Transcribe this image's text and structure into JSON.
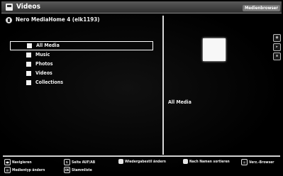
{
  "header": {
    "title": "Videos",
    "browser_label": "Medienbrowser"
  },
  "server": {
    "label": "Nero MediaHome 4 (elk1193)"
  },
  "menu": {
    "items": [
      {
        "label": "All Media",
        "selected": true
      },
      {
        "label": "Music",
        "selected": false
      },
      {
        "label": "Photos",
        "selected": false
      },
      {
        "label": "Videos",
        "selected": false
      },
      {
        "label": "Collections",
        "selected": false
      }
    ]
  },
  "preview": {
    "caption": "All Media"
  },
  "footer": {
    "navigate": "Navigieren",
    "page": "Seite AUF/AB",
    "play": "Wiedergabestil ändern",
    "sort": "Nach Namen sortieren",
    "browser": "Verz.-Browser",
    "mediatype": "Medientyp ändern",
    "mark": "Stammliste"
  },
  "colors": {
    "background": "#000000",
    "text": "#f0f0f0",
    "title_bar": "#3f3f3f"
  }
}
